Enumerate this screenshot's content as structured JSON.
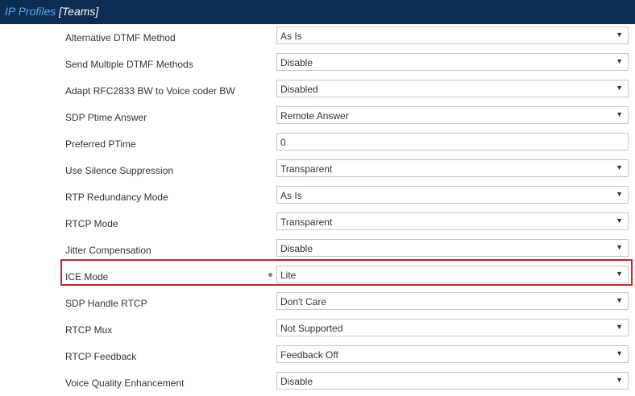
{
  "header": {
    "section": "IP Profiles",
    "entity": "[Teams]"
  },
  "rows": [
    {
      "label": "Alternative DTMF Method",
      "value": "As Is",
      "type": "select"
    },
    {
      "label": "Send Multiple DTMF Methods",
      "value": "Disable",
      "type": "select"
    },
    {
      "label": "Adapt RFC2833 BW to Voice coder BW",
      "value": "Disabled",
      "type": "select"
    },
    {
      "label": "SDP Ptime Answer",
      "value": "Remote Answer",
      "type": "select"
    },
    {
      "label": "Preferred PTime",
      "value": "0",
      "type": "input"
    },
    {
      "label": "Use Silence Suppression",
      "value": "Transparent",
      "type": "select"
    },
    {
      "label": "RTP Redundancy Mode",
      "value": "As Is",
      "type": "select"
    },
    {
      "label": "RTCP Mode",
      "value": "Transparent",
      "type": "select"
    },
    {
      "label": "Jitter Compensation",
      "value": "Disable",
      "type": "select"
    },
    {
      "label": "ICE Mode",
      "value": "Lite",
      "type": "select",
      "modified": true
    },
    {
      "label": "SDP Handle RTCP",
      "value": "Don't Care",
      "type": "select"
    },
    {
      "label": "RTCP Mux",
      "value": "Not Supported",
      "type": "select"
    },
    {
      "label": "RTCP Feedback",
      "value": "Feedback Off",
      "type": "select"
    },
    {
      "label": "Voice Quality Enhancement",
      "value": "Disable",
      "type": "select"
    }
  ],
  "icons": {
    "dropdown": "chevron-down-icon",
    "modified": "modified-dot-icon"
  },
  "colors": {
    "header_bg": "#0b2e52",
    "crumb": "#5fa9e6",
    "highlight": "#d0202a"
  }
}
